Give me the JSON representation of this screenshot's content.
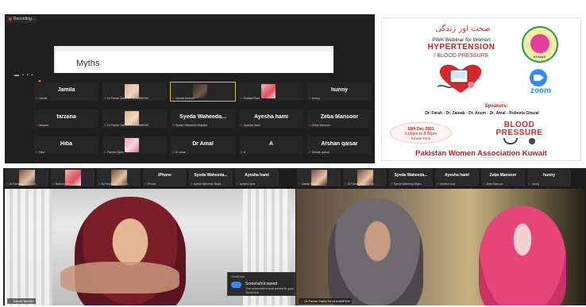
{
  "zoom_top": {
    "recording_label": "Recording...",
    "slide_title": "Myths",
    "view_controls": "▬ ▪ ▪ ▪",
    "participants": [
      {
        "name": "Jamila",
        "sub": "Jamila",
        "thumb": "none"
      },
      {
        "name": "",
        "sub": "Dr.Farrah Zahid Ed M.AHMEDW",
        "thumb": "face"
      },
      {
        "name": "",
        "sub": "Zainab Mohsin",
        "thumb": "dark",
        "speaking": true
      },
      {
        "name": "",
        "sub": "Rabiad Rabi",
        "thumb": "rose"
      },
      {
        "name": "hunny",
        "sub": "hunny",
        "thumb": "none"
      },
      {
        "name": "farzana",
        "sub": "farzana",
        "thumb": "none"
      },
      {
        "name": "",
        "sub": "Dr.Farrah Zahid Ed M.AHMEDW",
        "thumb": "face"
      },
      {
        "name": "Syeda Waheeda...",
        "sub": "Syeda Waheeda Mujtaba",
        "thumb": "none"
      },
      {
        "name": "Ayesha hami",
        "sub": "Ayesha hami",
        "thumb": "none"
      },
      {
        "name": "Zeba Mansoor",
        "sub": "Zeba Mansoor",
        "thumb": "none"
      },
      {
        "name": "Hiba",
        "sub": "Hiba",
        "thumb": "none"
      },
      {
        "name": "",
        "sub": "Fareha Naim",
        "thumb": "pink"
      },
      {
        "name": "Dr Amal",
        "sub": "Dr Amal",
        "thumb": "none"
      },
      {
        "name": "A",
        "sub": "A",
        "thumb": "none"
      },
      {
        "name": "Afshan qaisar",
        "sub": "Afshan qaisar",
        "thumb": "none"
      }
    ]
  },
  "poster": {
    "urdu_title": "صحت اور زندگی",
    "webinar": "PWA Webinar for Women",
    "headline": "HYPERTENSION",
    "subheadline": "/ BLOOD PRESSURE",
    "logo_text": "KUWAIT",
    "zoom_text": "zoom",
    "speakers_label": "Speakers:",
    "speakers": "Dr. Farah - Dr. Zainab - Dr. Anum - Dr. Amal - Robeeta Ghazal",
    "date": "18th Dec 2021",
    "time": "6:00pm to 8:00pm",
    "timezone": "Kuwait Time",
    "bp_line1": "BLOOD",
    "bp_line2": "PRESSURE",
    "organization": "Pakistan Women Association Kuwait",
    "colors": {
      "accent_red": "#cc1f1a",
      "zoom_blue": "#2d8cff",
      "logo_green": "#1aa44a"
    }
  },
  "zoom_bottom": {
    "strip": [
      {
        "name": "",
        "sub": "Dr.Farrah Zahid Ed M...",
        "thumb": "face"
      },
      {
        "name": "",
        "sub": "Rabiad Rabi",
        "thumb": "rose"
      },
      {
        "name": "",
        "sub": "Dr.Farrah Zahid Ed M...",
        "thumb": "face"
      },
      {
        "name": "iPhone",
        "sub": "iPhone",
        "thumb": "none"
      },
      {
        "name": "Syeda Waheeda...",
        "sub": "Syeda Waheeda Mujta...",
        "thumb": "none"
      },
      {
        "name": "Ayesha hami",
        "sub": "Ayesha hami",
        "thumb": "none"
      },
      {
        "name": "",
        "sub": "Zainab Mohsin",
        "thumb": "face"
      },
      {
        "name": "",
        "sub": "Dr.Farrah Zahid Ed M...",
        "thumb": "face"
      },
      {
        "name": "Syeda Waheeda...",
        "sub": "Syeda Waheeda Mujta...",
        "thumb": "none"
      },
      {
        "name": "Ayesha hami",
        "sub": "Ayesha hami",
        "thumb": "none"
      },
      {
        "name": "Zeba Mansoor",
        "sub": "Zeba Mansoor",
        "thumb": "none"
      },
      {
        "name": "hunny",
        "sub": "hunny",
        "thumb": "none"
      }
    ],
    "video_left_label": "Zainab Mohsin",
    "video_right_label": "Dr.Farrah Zahid Ed M.AHMEDW",
    "toast": {
      "app": "OneDrive",
      "title": "Screenshot saved",
      "message": "The screenshot was added to your OneDrive."
    }
  }
}
